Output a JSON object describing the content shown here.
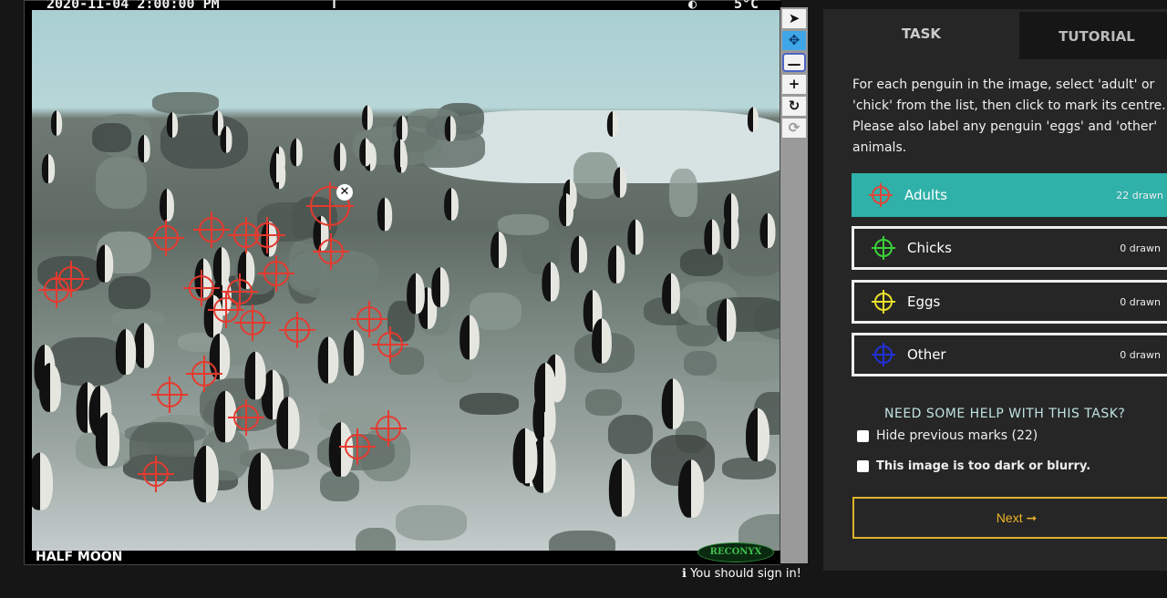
{
  "camera": {
    "datetime": "2020-11-04 2:00:00 PM",
    "flag": "T",
    "moon": "◐",
    "temperature": "5°C",
    "site": "HALF MOON",
    "brand": "RECONYX"
  },
  "tools": [
    {
      "name": "pointer",
      "glyph": "➤"
    },
    {
      "name": "pan",
      "glyph": "✥"
    },
    {
      "name": "zoom-out",
      "glyph": "—"
    },
    {
      "name": "zoom-in",
      "glyph": "+"
    },
    {
      "name": "rotate",
      "glyph": "↻"
    },
    {
      "name": "reset",
      "glyph": "⟳"
    }
  ],
  "signin": "You should sign in!",
  "tabs": {
    "task": "TASK",
    "tutorial": "TUTORIAL"
  },
  "instructions": "For each penguin in the image, select 'adult' or 'chick' from the list, then click to mark its centre. Please also label any penguin 'eggs' and 'other' animals.",
  "choices": [
    {
      "label": "Adults",
      "count": "22 drawn",
      "color": "#e0463a"
    },
    {
      "label": "Chicks",
      "count": "0 drawn",
      "color": "#3ad13a"
    },
    {
      "label": "Eggs",
      "count": "0 drawn",
      "color": "#e8e02a"
    },
    {
      "label": "Other",
      "count": "0 drawn",
      "color": "#2230d8"
    }
  ],
  "help": "NEED SOME HELP WITH THIS TASK?",
  "hide_marks": "Hide previous marks (22)",
  "too_dark": "This image is too dark or blurry.",
  "next": "Next ➞",
  "colors": {
    "accent": "#2fb0a8",
    "next": "#e0b22c",
    "mark": "#e53a2f"
  }
}
